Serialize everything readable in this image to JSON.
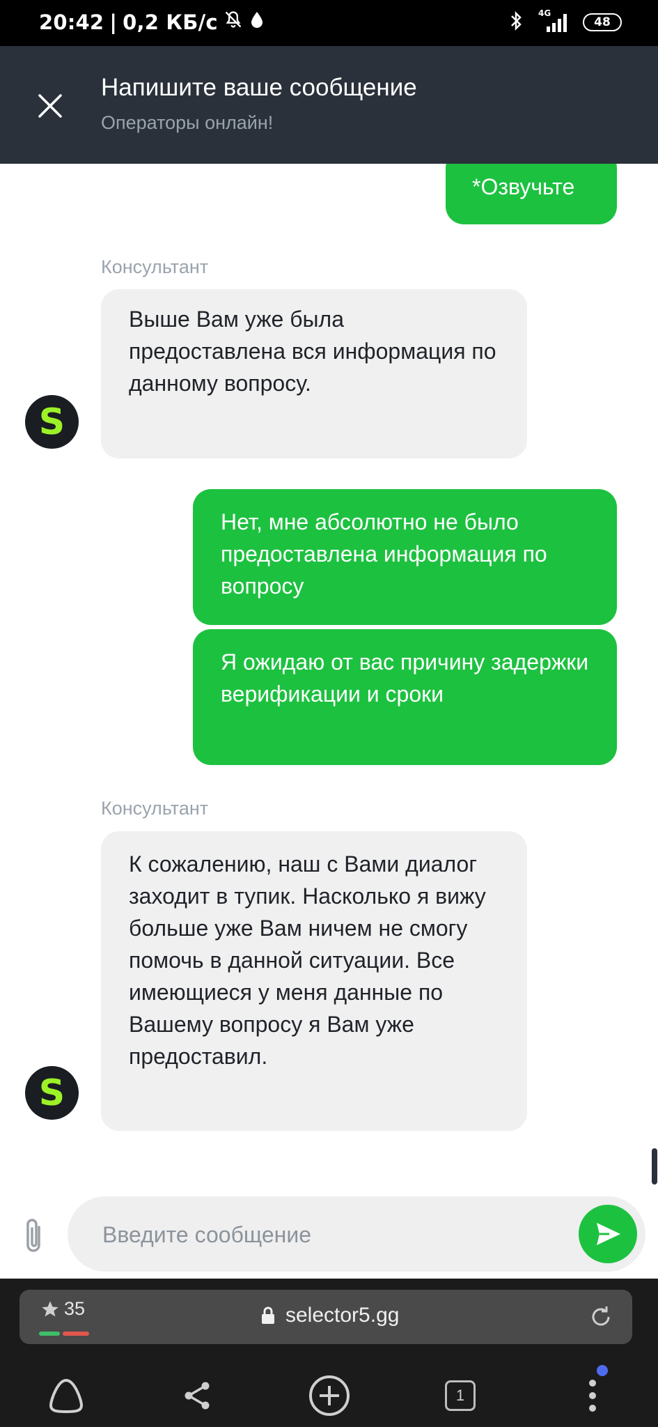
{
  "status_bar": {
    "time": "20:42",
    "network_speed": "0,2 КБ/с",
    "network_type": "4G",
    "battery": "48",
    "icons": [
      "bell-off-icon",
      "drop-icon",
      "bluetooth-icon",
      "signal-icon",
      "battery-icon"
    ]
  },
  "header": {
    "title": "Напишите ваше сообщение",
    "subtitle": "Операторы онлайн!"
  },
  "messages": [
    {
      "type": "out",
      "text": "*Озвучьте"
    },
    {
      "type": "in",
      "sender": "Консультант",
      "avatar": "S",
      "text": "Выше Вам уже была предоставлена вся информация по данному вопросу."
    },
    {
      "type": "out",
      "text": "Нет, мне абсолютно не было предоставлена информация по вопросу"
    },
    {
      "type": "out",
      "text": "Я ожидаю от вас причину задержки верификации и сроки"
    },
    {
      "type": "in",
      "sender": "Консультант",
      "avatar": "S",
      "text": "К сожалению, наш с Вами диалог заходит в тупик. Насколько я вижу больше уже Вам ничем не смогу помочь в данной ситуации. Все имеющиеся у меня данные по Вашему вопросу я Вам уже предоставил."
    }
  ],
  "composer": {
    "placeholder": "Введите сообщение",
    "value": ""
  },
  "browser": {
    "rating": "35",
    "url": "selector5.gg",
    "tab_count": "1"
  },
  "colors": {
    "accent_green": "#1dc140",
    "header_bg": "#2a313b",
    "avatar_letter": "#9cf227"
  }
}
